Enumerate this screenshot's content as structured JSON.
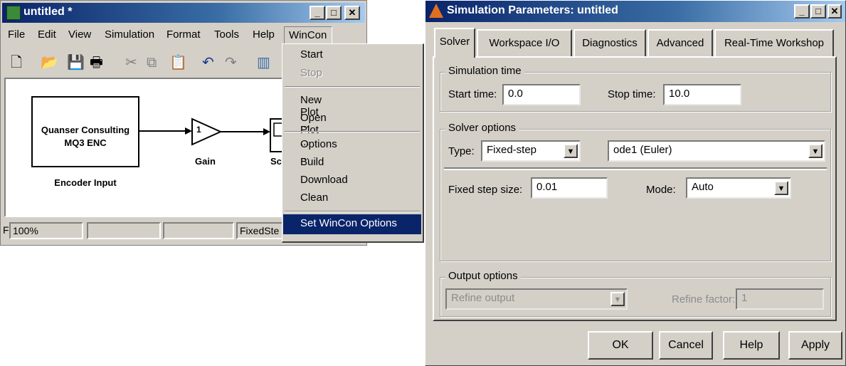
{
  "simulink": {
    "title": "untitled *",
    "menu": [
      "File",
      "Edit",
      "View",
      "Simulation",
      "Format",
      "Tools",
      "Help",
      "WinCon"
    ],
    "blocks": {
      "encoder_line1": "Quanser Consulting",
      "encoder_line2": "MQ3 ENC",
      "encoder_label": "Encoder Input",
      "gain_value": "1",
      "gain_label": "Gain",
      "scope_label": "Sc"
    },
    "status": {
      "prefix": "F",
      "zoom": "100%",
      "solver": "FixedSte"
    },
    "wincon_menu": {
      "items": [
        "Start",
        "Stop",
        "New Plot ...",
        "Open Plot ...",
        "Options ...",
        "Build",
        "Download",
        "Clean",
        "Set WinCon Options"
      ],
      "disabled": [
        "Stop"
      ],
      "highlighted": "Set WinCon Options"
    }
  },
  "dialog": {
    "title": "Simulation Parameters: untitled",
    "tabs": [
      "Solver",
      "Workspace I/O",
      "Diagnostics",
      "Advanced",
      "Real-Time Workshop"
    ],
    "active_tab": "Solver",
    "simulation_time": {
      "group_label": "Simulation time",
      "start_label": "Start time:",
      "start_value": "0.0",
      "stop_label": "Stop time:",
      "stop_value": "10.0"
    },
    "solver_options": {
      "group_label": "Solver options",
      "type_label": "Type:",
      "type_value": "Fixed-step",
      "solver_value": "ode1 (Euler)",
      "step_label": "Fixed step size:",
      "step_value": "0.01",
      "mode_label": "Mode:",
      "mode_value": "Auto"
    },
    "output_options": {
      "group_label": "Output options",
      "output_value": "Refine output",
      "refine_label": "Refine factor:",
      "refine_value": "1"
    },
    "buttons": [
      "OK",
      "Cancel",
      "Help",
      "Apply"
    ]
  },
  "colors": {
    "window_face": "#d4d0c8",
    "titlebar": "#0a246a",
    "menu_highlight": "#0a246a"
  }
}
